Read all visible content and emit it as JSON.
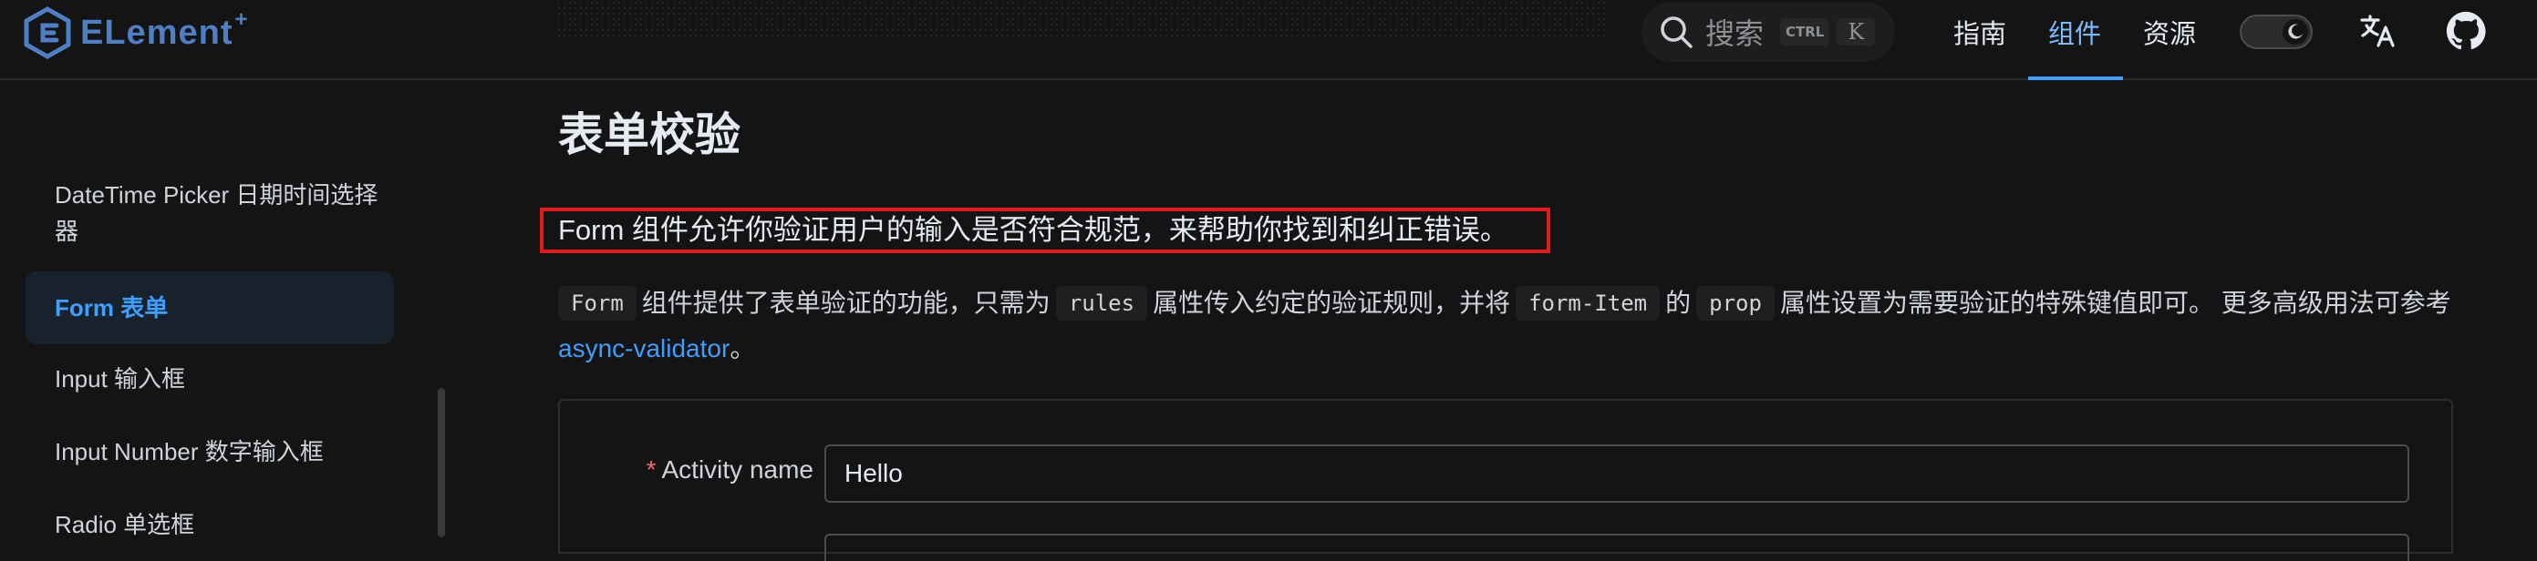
{
  "header": {
    "logo_text": "ELement",
    "logo_sup": "+",
    "search_label": "搜索",
    "search_kbd_ctrl": "CTRL",
    "search_kbd_k": "K",
    "nav": [
      {
        "label": "指南"
      },
      {
        "label": "组件"
      },
      {
        "label": "资源"
      }
    ],
    "active_nav": "组件",
    "icons": [
      "search-icon",
      "moon-icon",
      "translate-icon",
      "github-icon"
    ]
  },
  "sidebar": {
    "items": [
      {
        "label": "DateTime Picker 日期时间选择器"
      },
      {
        "label": "Form 表单"
      },
      {
        "label": "Input 输入框"
      },
      {
        "label": "Input Number 数字输入框"
      },
      {
        "label": "Radio 单选框"
      }
    ],
    "active_index": 1
  },
  "main": {
    "title": "表单校验",
    "intro": "Form 组件允许你验证用户的输入是否符合规范，来帮助你找到和纠正错误。",
    "desc": {
      "code_form": "Form",
      "text_1": "组件提供了表单验证的功能，只需为",
      "code_rules": "rules",
      "text_2": "属性传入约定的验证规则，并将",
      "code_form_item": "form-Item",
      "text_3": "的",
      "code_prop": "prop",
      "text_4": "属性设置为需要验证的特殊键值即可。 更多高级用法可参考",
      "link": "async-validator",
      "text_5": "。"
    },
    "form": {
      "required_mark": "*",
      "activity_name_label": "Activity name",
      "activity_name_value": "Hello"
    }
  },
  "colors": {
    "accent": "#409eff",
    "highlight_border": "#e11b1b",
    "required": "#f56c6c"
  }
}
